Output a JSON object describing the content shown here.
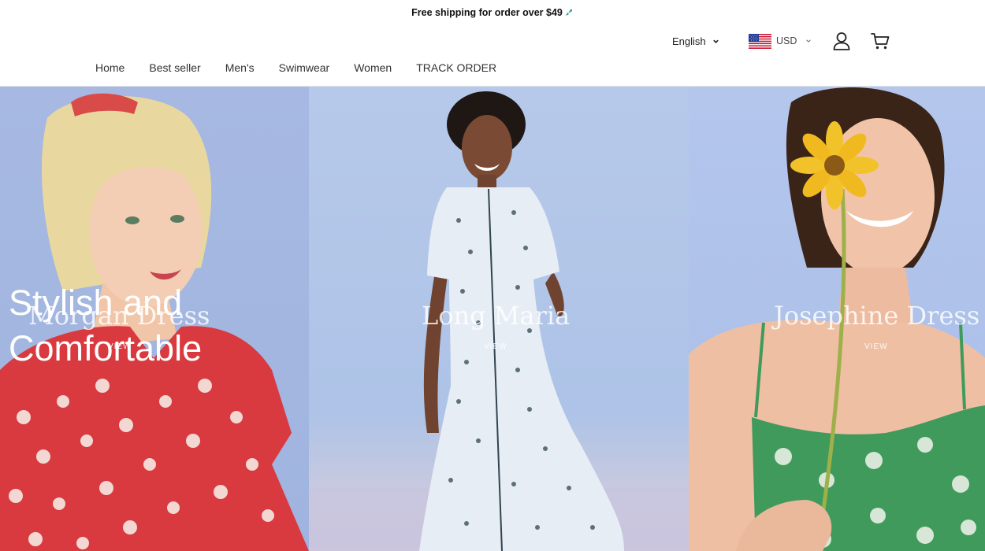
{
  "announcement": {
    "text": "Free shipping for order over $49",
    "icon": "rocket-icon"
  },
  "header": {
    "language": {
      "selected": "English",
      "icon": "chevron-down-icon"
    },
    "currency": {
      "selected": "USD",
      "flag_icon": "us-flag-icon",
      "icon": "chevron-down-icon"
    },
    "account_icon": "user-icon",
    "cart_icon": "cart-icon"
  },
  "nav": {
    "items": [
      "Home",
      "Best seller",
      "Men's",
      "Swimwear",
      "Women",
      "TRACK ORDER"
    ]
  },
  "hero": {
    "headline_line1": "Stylish and",
    "headline_line2": "Comfortable",
    "panels": [
      {
        "title": "Morgan Dress",
        "cta": "VIEW"
      },
      {
        "title": "Long Maria",
        "cta": "VIEW"
      },
      {
        "title": "Josephine Dress",
        "cta": "VIEW"
      }
    ]
  },
  "colors": {
    "accent_rocket": "#1aa39a",
    "hero_bg": "#a9bde8",
    "dress_red": "#d93a3f",
    "dress_green": "#3f9a5b",
    "flower_yellow": "#f2c22b"
  }
}
